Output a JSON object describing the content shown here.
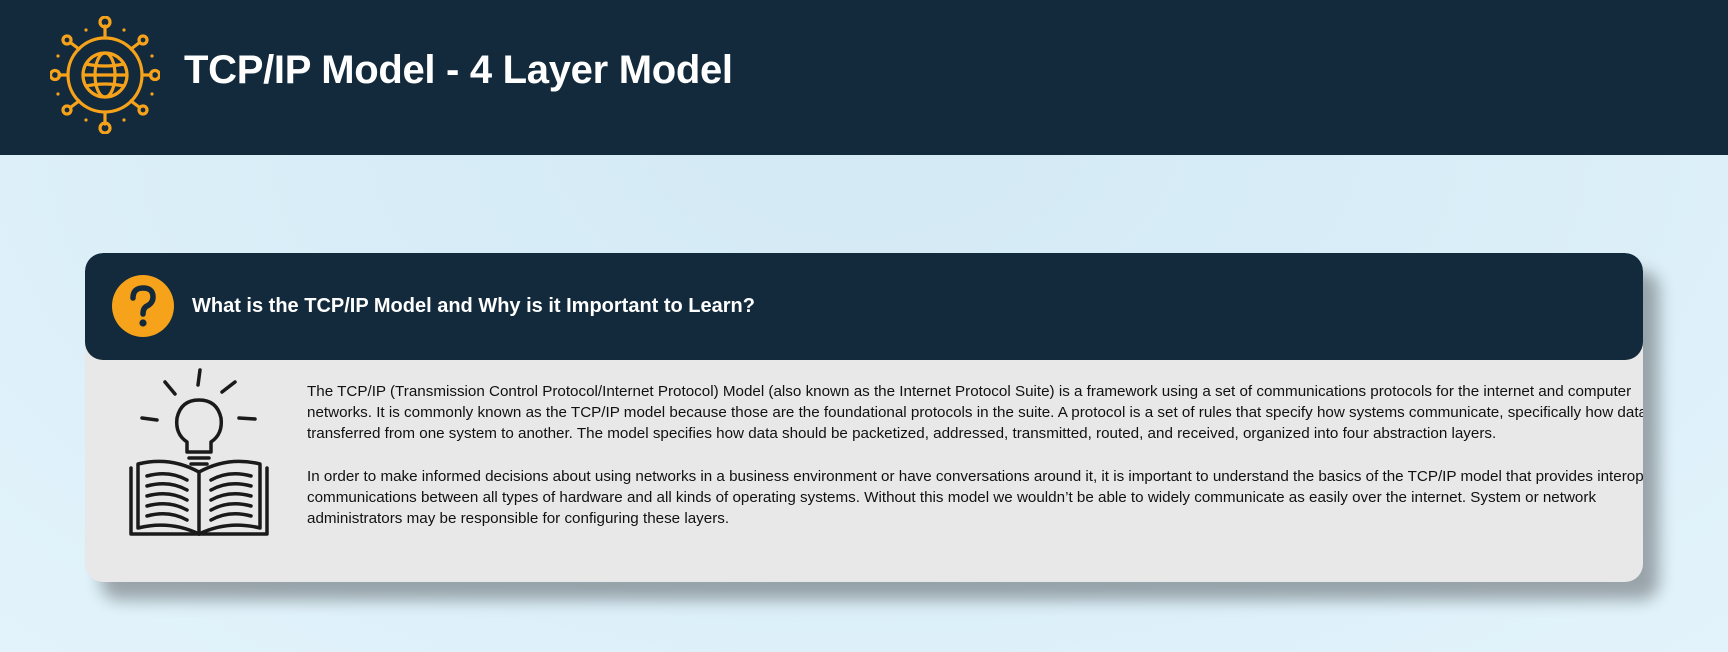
{
  "header": {
    "title": "TCP/IP Model - 4 Layer Model",
    "logo_icon": "network-globe-icon",
    "background": "#122a3b",
    "accent": "#f6a21b"
  },
  "card": {
    "title": "What is the TCP/IP Model and Why is it Important to Learn?",
    "title_icon": "question-mark-icon",
    "illustration_icon": "book-lightbulb-icon",
    "paragraphs": [
      "The TCP/IP (Transmission Control Protocol/Internet Protocol) Model (also known as the Internet Protocol Suite) is a framework using a set of communications protocols for the internet and computer networks. It is commonly known as the TCP/IP model because those are the foundational protocols in the suite. A protocol is a set of rules that specify how systems communicate, specifically how data is transferred from one system to another. The model specifies how data should be packetized, addressed, transmitted, routed, and received, organized into four abstraction layers.",
      "In order to make informed decisions about using networks in a business environment or have conversations around it, it is important to understand the basics of the TCP/IP model that provides interoperable communications between all types of hardware and all kinds of operating systems. Without this model we wouldn’t be able to widely communicate as easily over the internet. System or network administrators may be responsible for configuring these layers."
    ]
  }
}
